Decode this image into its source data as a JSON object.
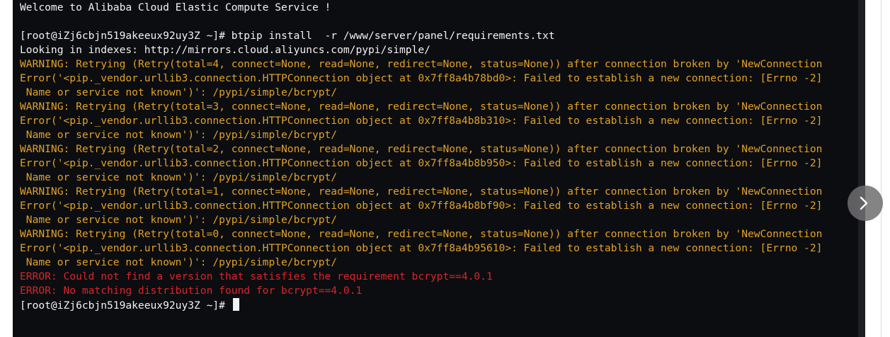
{
  "terminal": {
    "lines": [
      {
        "text": "Welcome to Alibaba Cloud Elastic Compute Service !",
        "kind": "normal"
      },
      {
        "text": "",
        "kind": "normal"
      },
      {
        "text": "[root@iZj6cbjn519akeeux92uy3Z ~]# btpip install  -r /www/server/panel/requirements.txt",
        "kind": "normal"
      },
      {
        "text": "Looking in indexes: http://mirrors.cloud.aliyuncs.com/pypi/simple/",
        "kind": "normal"
      },
      {
        "text": "WARNING: Retrying (Retry(total=4, connect=None, read=None, redirect=None, status=None)) after connection broken by 'NewConnection",
        "kind": "warning"
      },
      {
        "text": "Error('<pip._vendor.urllib3.connection.HTTPConnection object at 0x7ff8a4b78bd0>: Failed to establish a new connection: [Errno -2]",
        "kind": "warning"
      },
      {
        "text": " Name or service not known')': /pypi/simple/bcrypt/",
        "kind": "warning"
      },
      {
        "text": "WARNING: Retrying (Retry(total=3, connect=None, read=None, redirect=None, status=None)) after connection broken by 'NewConnection",
        "kind": "warning"
      },
      {
        "text": "Error('<pip._vendor.urllib3.connection.HTTPConnection object at 0x7ff8a4b8b310>: Failed to establish a new connection: [Errno -2]",
        "kind": "warning"
      },
      {
        "text": " Name or service not known')': /pypi/simple/bcrypt/",
        "kind": "warning"
      },
      {
        "text": "WARNING: Retrying (Retry(total=2, connect=None, read=None, redirect=None, status=None)) after connection broken by 'NewConnection",
        "kind": "warning"
      },
      {
        "text": "Error('<pip._vendor.urllib3.connection.HTTPConnection object at 0x7ff8a4b8b950>: Failed to establish a new connection: [Errno -2]",
        "kind": "warning"
      },
      {
        "text": " Name or service not known')': /pypi/simple/bcrypt/",
        "kind": "warning"
      },
      {
        "text": "WARNING: Retrying (Retry(total=1, connect=None, read=None, redirect=None, status=None)) after connection broken by 'NewConnection",
        "kind": "warning"
      },
      {
        "text": "Error('<pip._vendor.urllib3.connection.HTTPConnection object at 0x7ff8a4b8bf90>: Failed to establish a new connection: [Errno -2]",
        "kind": "warning"
      },
      {
        "text": " Name or service not known')': /pypi/simple/bcrypt/",
        "kind": "warning"
      },
      {
        "text": "WARNING: Retrying (Retry(total=0, connect=None, read=None, redirect=None, status=None)) after connection broken by 'NewConnection",
        "kind": "warning"
      },
      {
        "text": "Error('<pip._vendor.urllib3.connection.HTTPConnection object at 0x7ff8a4b95610>: Failed to establish a new connection: [Errno -2]",
        "kind": "warning"
      },
      {
        "text": " Name or service not known')': /pypi/simple/bcrypt/",
        "kind": "warning"
      },
      {
        "text": "ERROR: Could not find a version that satisfies the requirement bcrypt==4.0.1",
        "kind": "error"
      },
      {
        "text": "ERROR: No matching distribution found for bcrypt==4.0.1",
        "kind": "error"
      }
    ],
    "prompt": "[root@iZj6cbjn519akeeux92uy3Z ~]# ",
    "colors": {
      "background": "#0c0d10",
      "normal": "#f2f2f2",
      "warning": "#e0a12a",
      "error": "#d9252a"
    }
  },
  "controls": {
    "next_icon": "chevron-right-icon"
  }
}
